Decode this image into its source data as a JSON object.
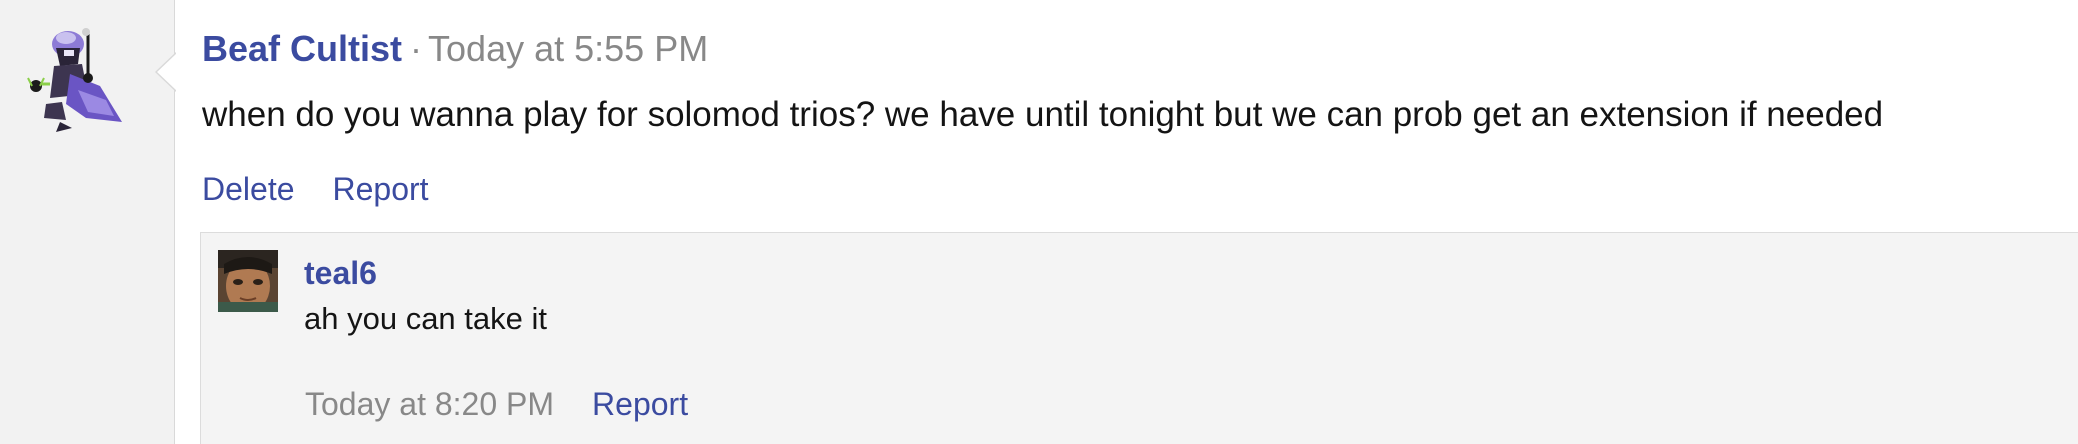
{
  "message": {
    "author": "Beaf Cultist",
    "separator": "·",
    "timestamp": "Today at 5:55 PM",
    "body": "when do you wanna play for solomod trios? we have until tonight but we can prob get an extension if needed",
    "actions": {
      "delete_label": "Delete",
      "report_label": "Report"
    }
  },
  "reply": {
    "author": "teal6",
    "body": "ah you can take it",
    "timestamp": "Today at 8:20 PM",
    "report_label": "Report"
  },
  "colors": {
    "link": "#3b4ba0",
    "muted": "#888888",
    "text": "#141414",
    "gutter": "#f2f2f2",
    "reply_bg": "#f4f4f4"
  }
}
